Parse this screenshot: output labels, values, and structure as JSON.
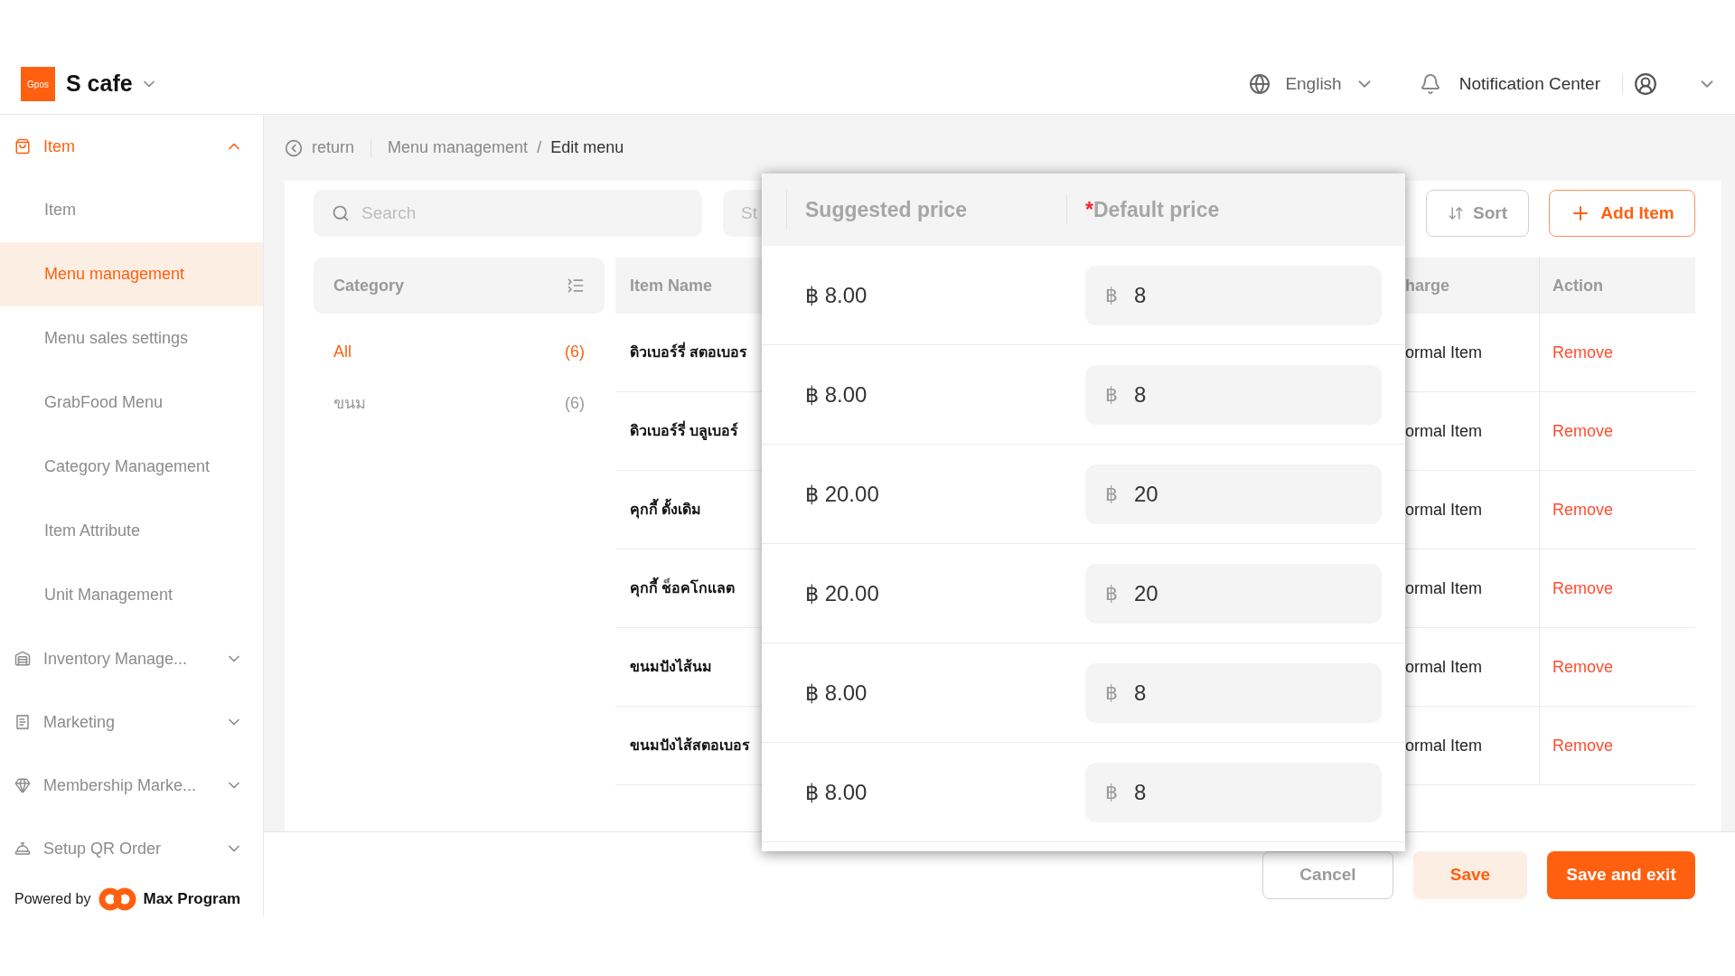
{
  "brand": {
    "logo_text": "Gpos",
    "name": "S cafe"
  },
  "header": {
    "language": "English",
    "notifications": "Notification Center"
  },
  "sidebar": {
    "groups": [
      {
        "label": "Item",
        "selected": true,
        "expanded": true,
        "children": [
          {
            "label": "Item",
            "selected": false
          },
          {
            "label": "Menu management",
            "selected": true
          },
          {
            "label": "Menu sales settings",
            "selected": false
          },
          {
            "label": "GrabFood Menu",
            "selected": false
          },
          {
            "label": "Category Management",
            "selected": false
          },
          {
            "label": "Item Attribute",
            "selected": false
          },
          {
            "label": "Unit Management",
            "selected": false
          }
        ]
      },
      {
        "label": "Inventory Manage...",
        "selected": false,
        "expanded": false
      },
      {
        "label": "Marketing",
        "selected": false,
        "expanded": false
      },
      {
        "label": "Membership Marke...",
        "selected": false,
        "expanded": false
      },
      {
        "label": "Setup QR Order",
        "selected": false,
        "expanded": false
      }
    ],
    "powered_by": {
      "label": "Powered by",
      "brand": "Max Program"
    }
  },
  "breadcrumb": {
    "back": "return",
    "separator": "/",
    "items": [
      {
        "label": "Menu management",
        "selected": false
      },
      {
        "label": "Edit menu",
        "selected": true
      }
    ]
  },
  "toolbar": {
    "search_placeholder": "Search",
    "filter_partial": "St",
    "sort": "Sort",
    "add": "Add Item"
  },
  "categories": {
    "title": "Category",
    "items": [
      {
        "label": "All",
        "count": "(6)",
        "selected": true
      },
      {
        "label": "ขนม",
        "count": "(6)",
        "selected": false
      }
    ]
  },
  "table": {
    "columns": [
      "Item Name",
      "harge",
      "Action"
    ],
    "rows": [
      {
        "name": "ดิวเบอร์รี่ สตอเบอร",
        "column_2": "ormal Item",
        "action": "Remove"
      },
      {
        "name": "ดิวเบอร์รี่ บลูเบอร์",
        "column_2": "ormal Item",
        "action": "Remove"
      },
      {
        "name": "คุกกี้ ดั้งเดิม",
        "column_2": "ormal Item",
        "action": "Remove"
      },
      {
        "name": "คุกกี้ ช็อคโกแลต",
        "column_2": "ormal Item",
        "action": "Remove"
      },
      {
        "name": "ขนมปังไส้นม",
        "column_2": "ormal Item",
        "action": "Remove"
      },
      {
        "name": "ขนมปังไส้สตอเบอร",
        "column_2": "ormal Item",
        "action": "Remove"
      }
    ]
  },
  "price_popup": {
    "columns": [
      {
        "label": "Suggested price"
      },
      {
        "label": "Default price",
        "required_mark": "*"
      }
    ],
    "rows": [
      {
        "suggested": "฿ 8.00",
        "currency": "฿",
        "value": "8"
      },
      {
        "suggested": "฿ 8.00",
        "currency": "฿",
        "value": "8"
      },
      {
        "suggested": "฿ 20.00",
        "currency": "฿",
        "value": "20"
      },
      {
        "suggested": "฿ 20.00",
        "currency": "฿",
        "value": "20"
      },
      {
        "suggested": "฿ 8.00",
        "currency": "฿",
        "value": "8"
      },
      {
        "suggested": "฿ 8.00",
        "currency": "฿",
        "value": "8"
      }
    ]
  },
  "footer": {
    "buttons": [
      {
        "label": "Cancel",
        "kind": "outline"
      },
      {
        "label": "Save",
        "kind": "soft"
      },
      {
        "label": "Save and exit",
        "kind": "primary"
      }
    ]
  }
}
